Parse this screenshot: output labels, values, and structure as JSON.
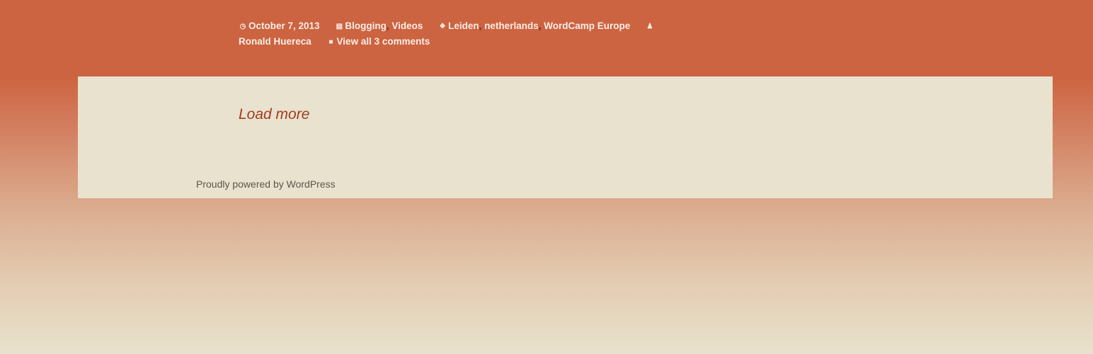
{
  "post_meta": {
    "date": "October 7, 2013",
    "categories": [
      "Blogging",
      "Videos"
    ],
    "tags": [
      "Leiden",
      "netherlands",
      "WordCamp Europe"
    ],
    "author": "Ronald Huereca",
    "comments": "View all 3 comments",
    "separator": ","
  },
  "pagination": {
    "load_more": "Load more"
  },
  "footer": {
    "credit": "Proudly powered by WordPress"
  },
  "colors": {
    "header_accent": "#cc6341",
    "panel_background": "#e8e2ce",
    "link_accent": "#a23c1f"
  }
}
